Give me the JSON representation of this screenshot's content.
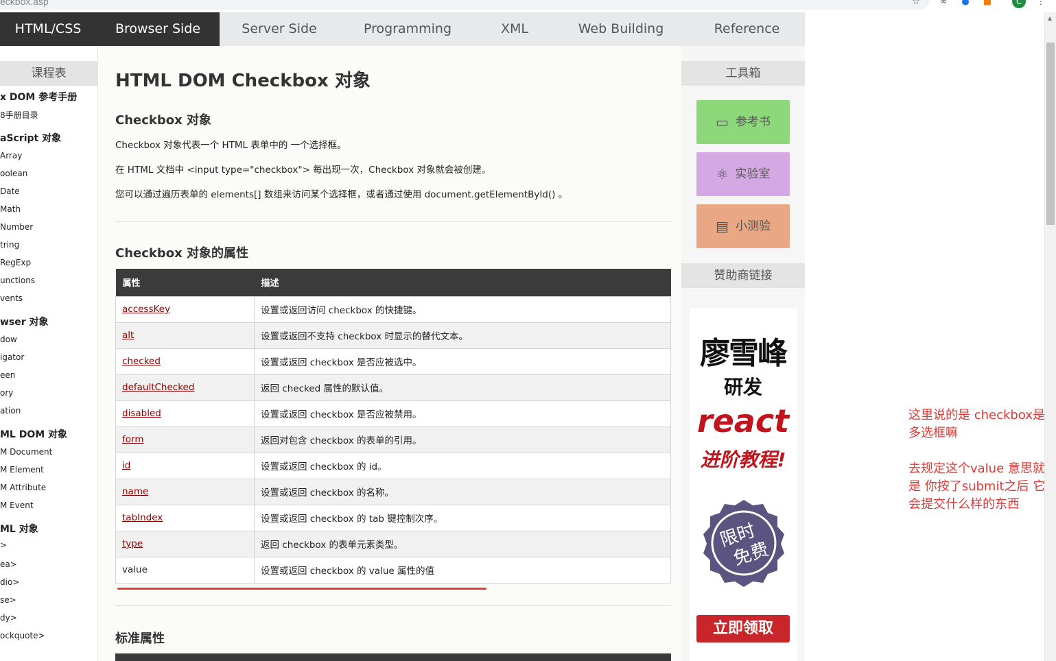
{
  "browser": {
    "url_text": "eckbox.asp",
    "avatar_letter": "C",
    "icons": [
      "bookmark-star-icon",
      "extension-icon",
      "extension-icon-2",
      "extension-icon-3",
      "menu-dots-icon"
    ]
  },
  "nav": {
    "items": [
      {
        "label": "HTML/CSS",
        "dark": true
      },
      {
        "label": "Browser Side",
        "dark": true
      },
      {
        "label": "Server Side",
        "dark": false
      },
      {
        "label": "Programming",
        "dark": false
      },
      {
        "label": "XML",
        "dark": false
      },
      {
        "label": "Web Building",
        "dark": false
      },
      {
        "label": "Reference",
        "dark": false
      }
    ]
  },
  "left": {
    "heading": "课程表",
    "items": [
      {
        "label": "x DOM 参考手册",
        "bold": true
      },
      {
        "label": "8手册目录",
        "bold": false
      },
      {
        "label": "aScript 对象",
        "bold": true
      },
      {
        "label": "Array",
        "bold": false
      },
      {
        "label": "oolean",
        "bold": false
      },
      {
        "label": "Date",
        "bold": false
      },
      {
        "label": "Math",
        "bold": false
      },
      {
        "label": "Number",
        "bold": false
      },
      {
        "label": "tring",
        "bold": false
      },
      {
        "label": "RegExp",
        "bold": false
      },
      {
        "label": "unctions",
        "bold": false
      },
      {
        "label": "vents",
        "bold": false
      },
      {
        "label": "wser 对象",
        "bold": true
      },
      {
        "label": "dow",
        "bold": false
      },
      {
        "label": "igator",
        "bold": false
      },
      {
        "label": "een",
        "bold": false
      },
      {
        "label": "ory",
        "bold": false
      },
      {
        "label": "ation",
        "bold": false
      },
      {
        "label": "ML DOM 对象",
        "bold": true
      },
      {
        "label": "M Document",
        "bold": false
      },
      {
        "label": "M Element",
        "bold": false
      },
      {
        "label": "M Attribute",
        "bold": false
      },
      {
        "label": "M Event",
        "bold": false
      },
      {
        "label": "ML 对象",
        "bold": true
      },
      {
        "label": ">",
        "bold": false
      },
      {
        "label": "ea>",
        "bold": false
      },
      {
        "label": "dio>",
        "bold": false
      },
      {
        "label": "se>",
        "bold": false
      },
      {
        "label": "dy>",
        "bold": false
      },
      {
        "label": "ockquote>",
        "bold": false
      }
    ]
  },
  "main": {
    "title": "HTML DOM Checkbox 对象",
    "section1_title": "Checkbox 对象",
    "para1": "Checkbox 对象代表一个 HTML 表单中的 一个选择框。",
    "para2": "在 HTML 文档中 <input type=\"checkbox\"> 每出现一次，Checkbox 对象就会被创建。",
    "para3": "您可以通过遍历表单的 elements[] 数组来访问某个选择框，或者通过使用 document.getElementById() 。",
    "section2_title": "Checkbox 对象的属性",
    "table_headers": [
      "属性",
      "描述"
    ],
    "rows": [
      {
        "prop": "accessKey",
        "desc": "设置或返回访问 checkbox 的快捷键。",
        "link": true
      },
      {
        "prop": "alt",
        "desc": "设置或返回不支持 checkbox 时显示的替代文本。",
        "link": true
      },
      {
        "prop": "checked",
        "desc": "设置或返回 checkbox 是否应被选中。",
        "link": true
      },
      {
        "prop": "defaultChecked",
        "desc": "返回 checked 属性的默认值。",
        "link": true
      },
      {
        "prop": "disabled",
        "desc": "设置或返回 checkbox 是否应被禁用。",
        "link": true
      },
      {
        "prop": "form",
        "desc": "返回对包含 checkbox 的表单的引用。",
        "link": true
      },
      {
        "prop": "id",
        "desc": "设置或返回 checkbox 的 id。",
        "link": true
      },
      {
        "prop": "name",
        "desc": "设置或返回 checkbox 的名称。",
        "link": true
      },
      {
        "prop": "tabIndex",
        "desc": "设置或返回 checkbox 的 tab 键控制次序。",
        "link": true
      },
      {
        "prop": "type",
        "desc": "返回 checkbox 的表单元素类型。",
        "link": true
      },
      {
        "prop": "value",
        "desc": "设置或返回 checkbox 的 value 属性的值",
        "link": false
      }
    ],
    "section3_title": "标准属性"
  },
  "right": {
    "toolbox_heading": "工具箱",
    "tools": [
      {
        "label": "参考书",
        "icon": "book-icon",
        "glyph": "▭",
        "color": "green"
      },
      {
        "label": "实验室",
        "icon": "atom-icon",
        "glyph": "⚛",
        "color": "purple"
      },
      {
        "label": "小测验",
        "icon": "clipboard-icon",
        "glyph": "▤",
        "color": "orange"
      }
    ],
    "sponsor_heading": "赞助商链接",
    "ad": {
      "name": "廖雪峰",
      "sub": "研发",
      "react": "react",
      "course": "进阶教程!",
      "badge_line1": "限时",
      "badge_line2": "免费",
      "button": "立即领取"
    }
  },
  "annotation": {
    "lines": [
      "这里说的是 checkbox是",
      "多选框嘛",
      "",
      "去规定这个value 意思就",
      "是 你按了submit之后 它",
      "会提交什么样的东西"
    ],
    "color": "#e53935"
  }
}
